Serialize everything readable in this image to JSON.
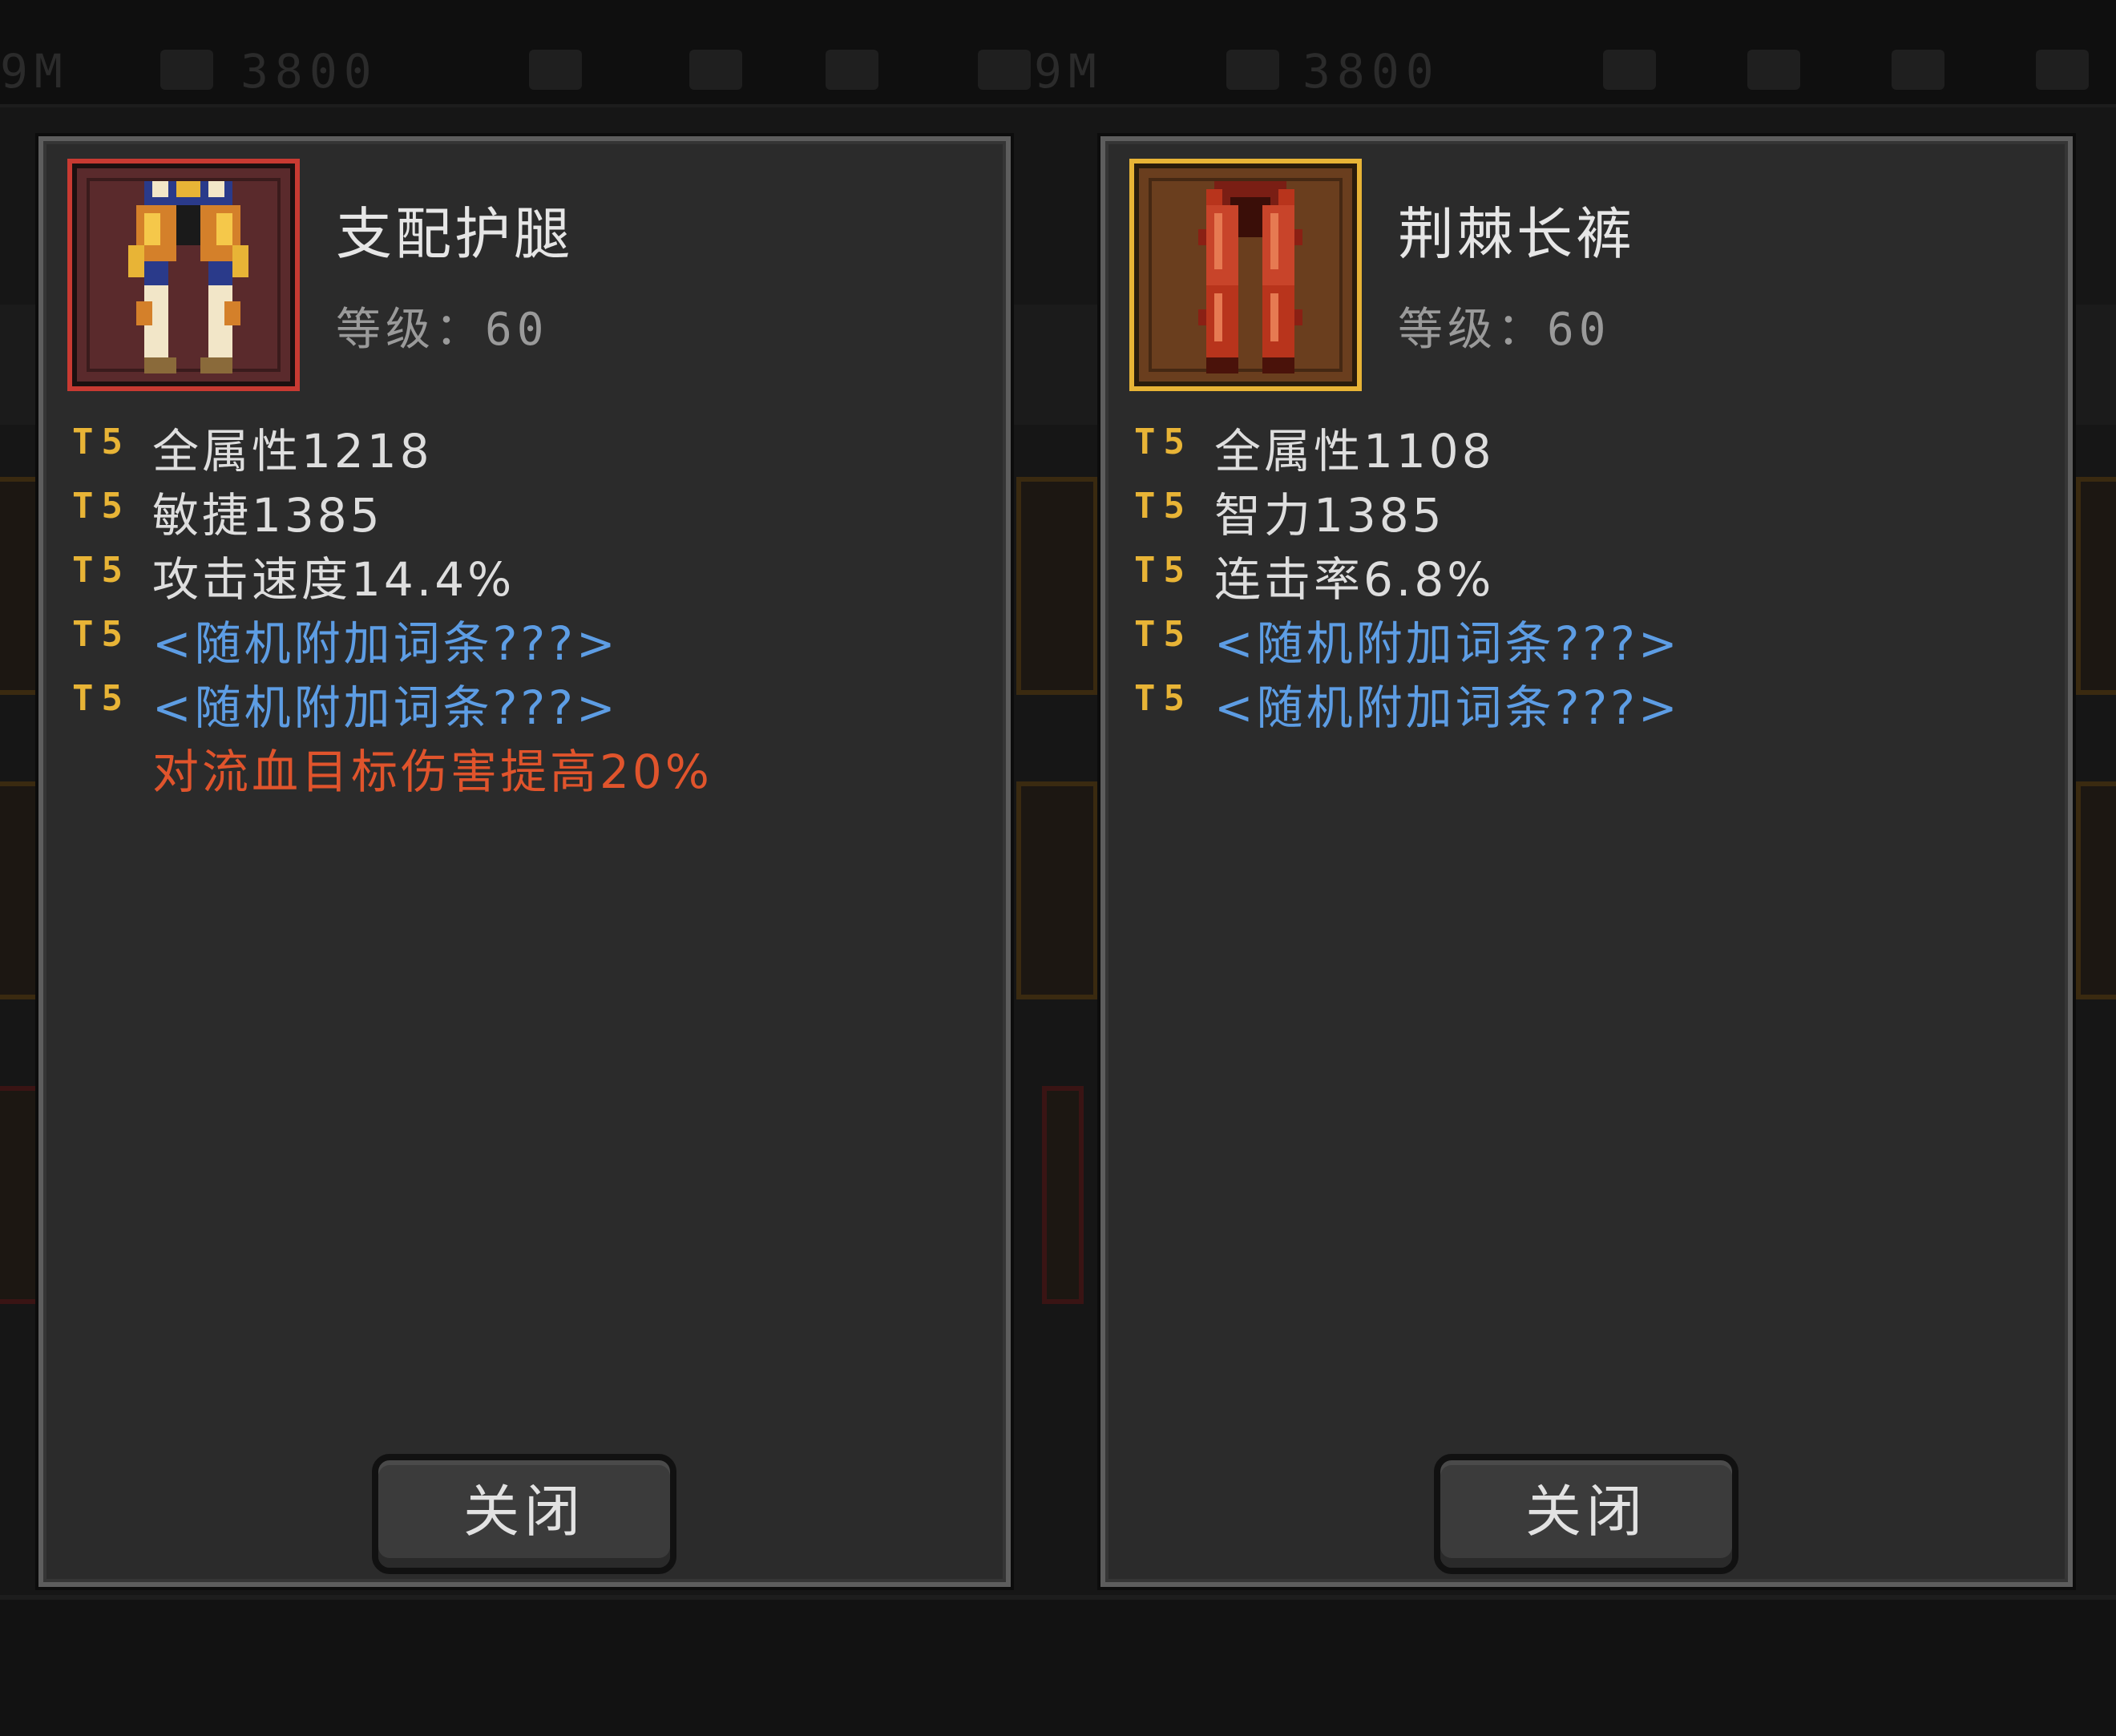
{
  "background": {
    "top_left_value": "3800",
    "top_right_value": "3800",
    "fragment_left": "9M",
    "fragment_mid": "9M"
  },
  "panels": [
    {
      "item_name": "支配护腿",
      "level_label": "等级：60",
      "rarity_color": "#c83a32",
      "icon": "leg-armor-icon",
      "stats": [
        {
          "tier": "T5",
          "text": "全属性1218",
          "type": "normal"
        },
        {
          "tier": "T5",
          "text": "敏捷1385",
          "type": "normal"
        },
        {
          "tier": "T5",
          "text": "攻击速度14.4%",
          "type": "normal"
        },
        {
          "tier": "T5",
          "text": "<随机附加词条???>",
          "type": "random"
        },
        {
          "tier": "T5",
          "text": "<随机附加词条???>",
          "type": "random"
        }
      ],
      "special": "对流血目标伤害提高20%",
      "close_label": "关闭"
    },
    {
      "item_name": "荆棘长裤",
      "level_label": "等级：60",
      "rarity_color": "#e8b436",
      "icon": "thorn-pants-icon",
      "stats": [
        {
          "tier": "T5",
          "text": "全属性1108",
          "type": "normal"
        },
        {
          "tier": "T5",
          "text": "智力1385",
          "type": "normal"
        },
        {
          "tier": "T5",
          "text": "连击率6.8%",
          "type": "normal"
        },
        {
          "tier": "T5",
          "text": "<随机附加词条???>",
          "type": "random"
        },
        {
          "tier": "T5",
          "text": "<随机附加词条???>",
          "type": "random"
        }
      ],
      "close_label": "关闭"
    }
  ]
}
